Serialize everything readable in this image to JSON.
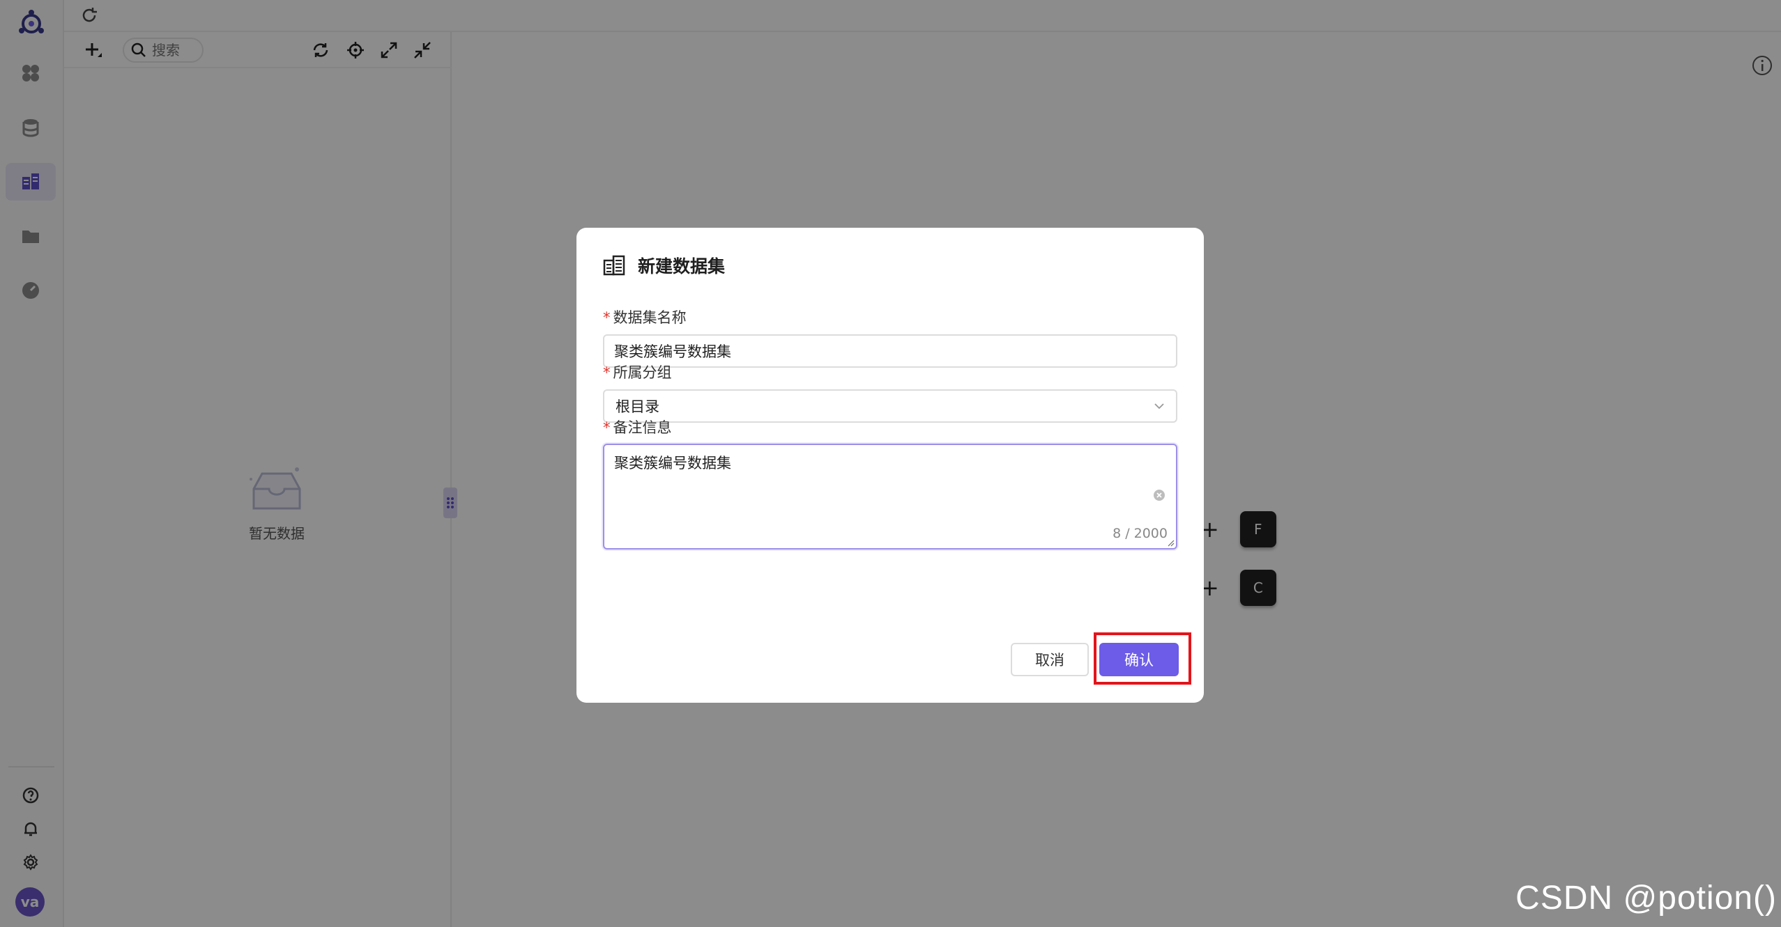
{
  "sidebar": {
    "nav_items": [
      "dashboard",
      "database",
      "dataset",
      "folder",
      "monitor"
    ],
    "bottom_items": [
      "help",
      "notifications",
      "settings"
    ],
    "avatar_text": "va"
  },
  "tree_panel": {
    "search_placeholder": "搜索",
    "empty_text": "暂无数据"
  },
  "shortcuts": [
    {
      "plus": "+",
      "key": "F"
    },
    {
      "plus": "+",
      "key": "C"
    }
  ],
  "modal": {
    "title": "新建数据集",
    "name_label": "数据集名称",
    "name_value": "聚类簇编号数据集",
    "group_label": "所属分组",
    "group_value": "根目录",
    "remark_label": "备注信息",
    "remark_value": "聚类簇编号数据集",
    "remark_counter": "8 / 2000",
    "required_mark": "*",
    "cancel_label": "取消",
    "confirm_label": "确认"
  },
  "watermark": "CSDN @potion()",
  "colors": {
    "accent": "#6c5ce7",
    "highlight": "#e3141b",
    "required": "#e0342c"
  }
}
